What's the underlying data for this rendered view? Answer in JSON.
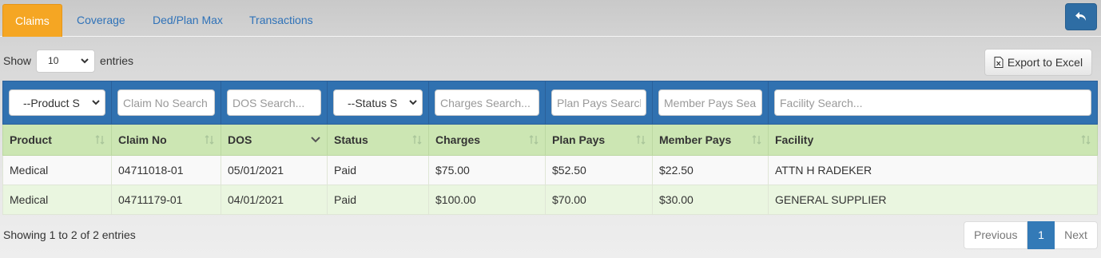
{
  "tabs": [
    {
      "label": "Claims",
      "active": true
    },
    {
      "label": "Coverage",
      "active": false
    },
    {
      "label": "Ded/Plan Max",
      "active": false
    },
    {
      "label": "Transactions",
      "active": false
    }
  ],
  "toolbar": {
    "back_icon": "reply-arrow-icon",
    "show_label": "Show",
    "entries_value": "10",
    "entries_label": "entries",
    "export_label": "Export to Excel",
    "export_icon": "excel-file-icon"
  },
  "filters": {
    "product": "--Product S",
    "claim_no": "Claim No Search",
    "dos": "DOS Search...",
    "status": "--Status S",
    "charges": "Charges Search...",
    "plan_pays": "Plan Pays Search...",
    "member_pays": "Member Pays Search...",
    "facility": "Facility Search..."
  },
  "columns": [
    "Product",
    "Claim No",
    "DOS",
    "Status",
    "Charges",
    "Plan Pays",
    "Member Pays",
    "Facility"
  ],
  "rows": [
    [
      "Medical",
      "04711018-01",
      "05/01/2021",
      "Paid",
      "$75.00",
      "$52.50",
      "$22.50",
      "ATTN H RADEKER"
    ],
    [
      "Medical",
      "04711179-01",
      "04/01/2021",
      "Paid",
      "$100.00",
      "$70.00",
      "$30.00",
      "GENERAL SUPPLIER"
    ]
  ],
  "footer": {
    "info": "Showing 1 to 2 of 2 entries",
    "previous": "Previous",
    "current_page": "1",
    "next": "Next"
  },
  "colors": {
    "active_tab": "#f5a623",
    "filter_bar": "#3071b0",
    "header_row": "#cce6b3",
    "primary": "#337ab7"
  }
}
